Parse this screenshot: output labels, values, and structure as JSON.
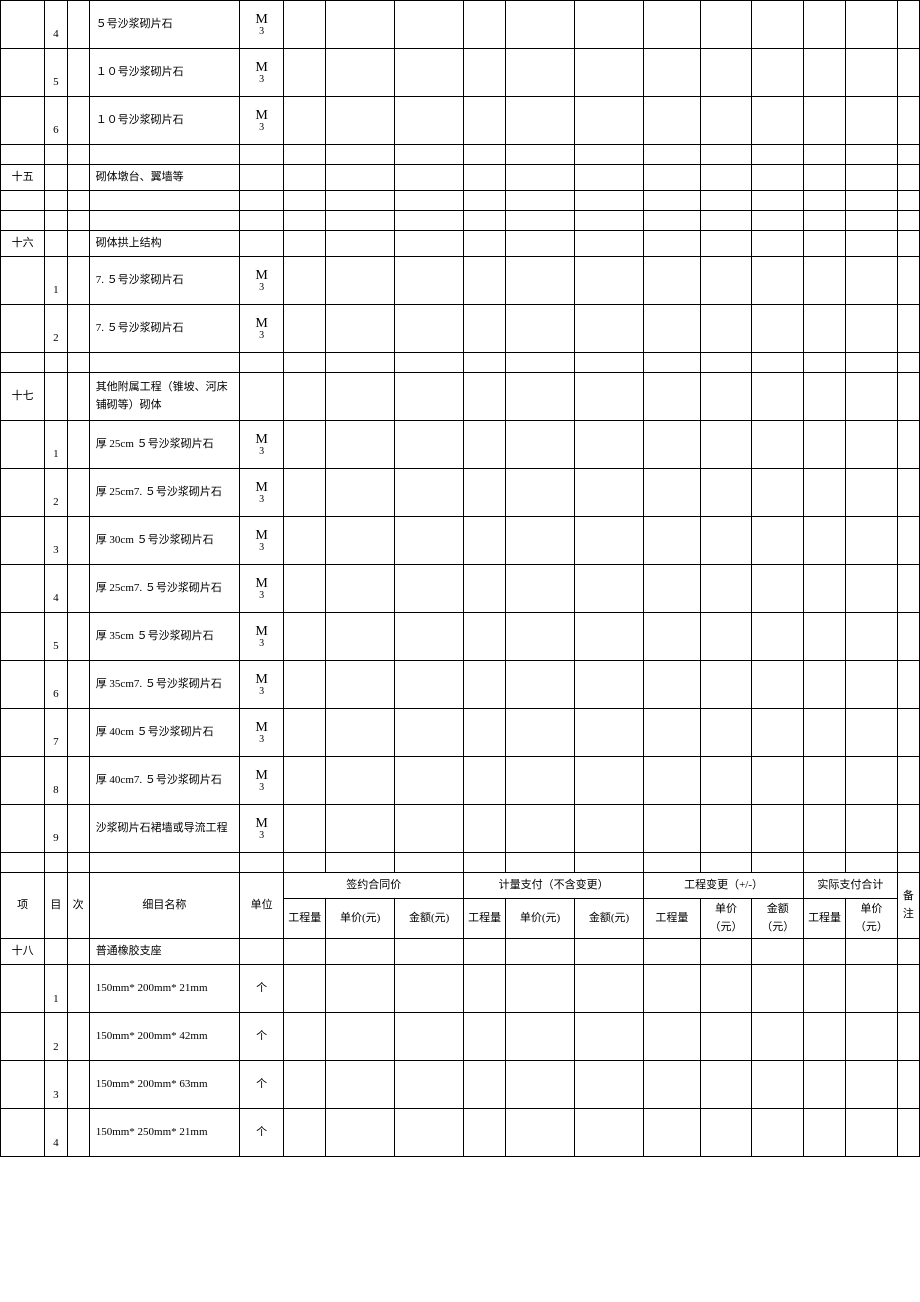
{
  "rows_top": [
    {
      "col1": "",
      "num": "4",
      "desc": "５号沙浆砌片石",
      "unit": "M3"
    },
    {
      "col1": "",
      "num": "5",
      "desc": "１０号沙浆砌片石",
      "unit": "M3"
    },
    {
      "col1": "",
      "num": "6",
      "desc": "１０号沙浆砌片石",
      "unit": "M3"
    }
  ],
  "section15": {
    "label": "十五",
    "title": "砌体墩台、翼墙等"
  },
  "section16": {
    "label": "十六",
    "title": "砌体拱上结构",
    "rows": [
      {
        "num": "1",
        "desc": "7. ５号沙浆砌片石",
        "unit": "M3"
      },
      {
        "num": "2",
        "desc": "7. ５号沙浆砌片石",
        "unit": "M3"
      }
    ]
  },
  "section17": {
    "label": "十七",
    "title": "其他附属工程（锥坡、河床铺砌等）砌体",
    "rows": [
      {
        "num": "1",
        "desc": "厚 25cm ５号沙浆砌片石",
        "unit": "M3"
      },
      {
        "num": "2",
        "desc": "厚 25cm7. ５号沙浆砌片石",
        "unit": "M3"
      },
      {
        "num": "3",
        "desc": "厚 30cm ５号沙浆砌片石",
        "unit": "M3"
      },
      {
        "num": "4",
        "desc": "厚 25cm7. ５号沙浆砌片石",
        "unit": "M3"
      },
      {
        "num": "5",
        "desc": "厚 35cm ５号沙浆砌片石",
        "unit": "M3"
      },
      {
        "num": "6",
        "desc": "厚 35cm7. ５号沙浆砌片石",
        "unit": "M3"
      },
      {
        "num": "7",
        "desc": "厚 40cm ５号沙浆砌片石",
        "unit": "M3"
      },
      {
        "num": "8",
        "desc": "厚 40cm7. ５号沙浆砌片石",
        "unit": "M3"
      },
      {
        "num": "9",
        "desc": "沙浆砌片石裙墙或导流工程",
        "unit": "M3"
      }
    ]
  },
  "header": {
    "proj": "项",
    "mu": "目",
    "ci": "次",
    "name": "细目名称",
    "unit": "单位",
    "g1": "签约合同价",
    "g2": "计量支付（不含变更）",
    "g3": "工程变更（+/-）",
    "g4": "实际支付合计",
    "qty": "工程量",
    "price": "单价(元)",
    "amount": "金额(元)",
    "price2": "单价（元）",
    "amount2": "金额（元）",
    "qty2": "工程量",
    "remark": "备注"
  },
  "section18": {
    "label": "十八",
    "title": "普通橡胶支座",
    "rows": [
      {
        "num": "1",
        "desc": " 150mm*  200mm*  21mm",
        "unit": "个"
      },
      {
        "num": "2",
        "desc": " 150mm*  200mm*  42mm",
        "unit": "个"
      },
      {
        "num": "3",
        "desc": " 150mm*  200mm*  63mm",
        "unit": "个"
      },
      {
        "num": "4",
        "desc": " 150mm*  250mm*  21mm",
        "unit": "个"
      }
    ]
  }
}
